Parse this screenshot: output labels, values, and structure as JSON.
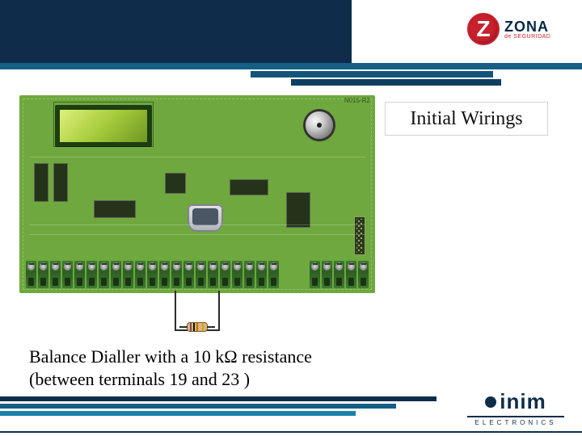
{
  "header": {
    "logo_zona": {
      "letter": "Z",
      "word": "ZONA",
      "subtitle": "de SEGURIDAD"
    }
  },
  "title_box": {
    "text": "Initial Wirings"
  },
  "caption": {
    "line1": "Balance Dialler with a 10 kΩ resistance",
    "line2": "(between terminals 19 and 23 )"
  },
  "pcb": {
    "terminal_count_left": 21,
    "terminal_count_right": 5,
    "board_label": "N015-R2"
  },
  "footer": {
    "logo_inim": {
      "word": "inim",
      "sub": "ELECTRONICS"
    }
  },
  "colors": {
    "header_bg": "#0f2d4a",
    "stripe1": "#155f87",
    "stripe2": "#14547a",
    "stripe3": "#0f3f60",
    "pcb": "#6fa83e",
    "brand_red": "#c8202d"
  }
}
